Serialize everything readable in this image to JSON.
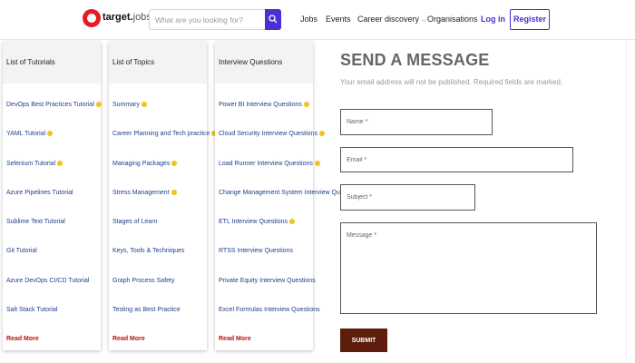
{
  "header": {
    "logo_text": "target",
    "logo_suffix": "jobs",
    "search_placeholder": "What are you looking for?",
    "nav": [
      "Jobs",
      "Events",
      "Career discovery",
      "Organisations"
    ],
    "login": "Log in",
    "register": "Register"
  },
  "columns": [
    {
      "title": "List of Tutorials",
      "items": [
        "DevOps Best Practices Tutorial",
        "YAML Tutorial",
        "Selenium Tutorial",
        "Azure Pipelines Tutorial",
        "Sublime Text Tutorial",
        "Git Tutorial",
        "Azure DevOps CI/CD Tutorial",
        "Salt Stack Tutorial"
      ],
      "read_more": "Read More"
    },
    {
      "title": "List of Topics",
      "items": [
        "Summary",
        "Career Planning and Tech practice",
        "Managing Packages",
        "Stress Management",
        "Stages of Learn",
        "Keys, Tools & Techniques",
        "Graph Process Safety",
        "Testing as Best Practice"
      ],
      "read_more": "Read More"
    },
    {
      "title": "Interview Questions",
      "items": [
        "Power BI Interview Questions",
        "Cloud Security Interview Questions",
        "Load Runner Interview Questions",
        "Change Management System Interview Questions",
        "ETL Interview Questions",
        "RTSS Interview Questions",
        "Private Equity Interview Questions",
        "Excel Formulas Interview Questions"
      ],
      "read_more": "Read More"
    }
  ],
  "form": {
    "title": "SEND A MESSAGE",
    "note": "Your email address will not be published. Required fields are marked.",
    "name_placeholder": "Name *",
    "email_placeholder": "Email *",
    "subject_placeholder": "Subject *",
    "message_placeholder": "Message *",
    "submit": "SUBMIT"
  },
  "colors": {
    "accent": "#4b2fd6",
    "logo_red": "#e31b23",
    "submit_bg": "#5c1d0c",
    "read_more": "#b51212"
  }
}
